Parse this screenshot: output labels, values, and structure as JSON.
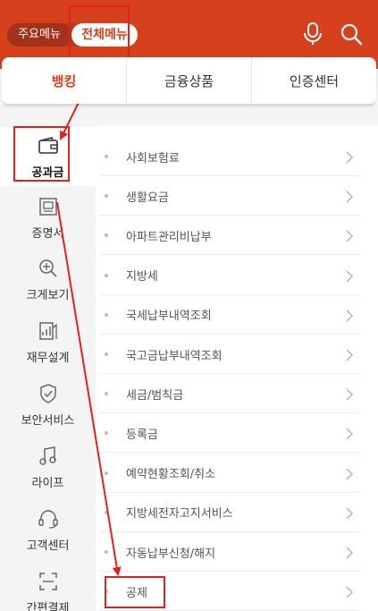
{
  "header": {
    "main_menu_label": "주요메뉴",
    "all_menu_label": "전체메뉴",
    "mic_icon": "mic-icon",
    "search_icon": "search-icon",
    "brand_color": "#d7401d"
  },
  "tabs": [
    {
      "label": "뱅킹",
      "active": true
    },
    {
      "label": "금융상품",
      "active": false
    },
    {
      "label": "인증센터",
      "active": false
    }
  ],
  "sidebar": {
    "items": [
      {
        "label": "공과금",
        "icon": "wallet-icon",
        "active": true
      },
      {
        "label": "증명서",
        "icon": "certificate-icon",
        "active": false
      },
      {
        "label": "크게보기",
        "icon": "zoom-in-icon",
        "active": false
      },
      {
        "label": "재무설계",
        "icon": "finance-plan-icon",
        "active": false
      },
      {
        "label": "보안서비스",
        "icon": "shield-check-icon",
        "active": false
      },
      {
        "label": "라이프",
        "icon": "music-note-icon",
        "active": false
      },
      {
        "label": "고객센터",
        "icon": "headset-icon",
        "active": false
      },
      {
        "label": "간편결제",
        "icon": "scan-icon",
        "active": false
      }
    ]
  },
  "menu": {
    "items": [
      {
        "label": "사회보험료"
      },
      {
        "label": "생활요금"
      },
      {
        "label": "아파트관리비납부"
      },
      {
        "label": "지방세"
      },
      {
        "label": "국세납부내역조회"
      },
      {
        "label": "국고금납부내역조회"
      },
      {
        "label": "세금/범칙금"
      },
      {
        "label": "등록금"
      },
      {
        "label": "예약현황조회/취소"
      },
      {
        "label": "지방세전자고지서비스"
      },
      {
        "label": "자동납부신청/해지"
      },
      {
        "label": "공제"
      }
    ]
  },
  "annotation_color": "#e3201b"
}
